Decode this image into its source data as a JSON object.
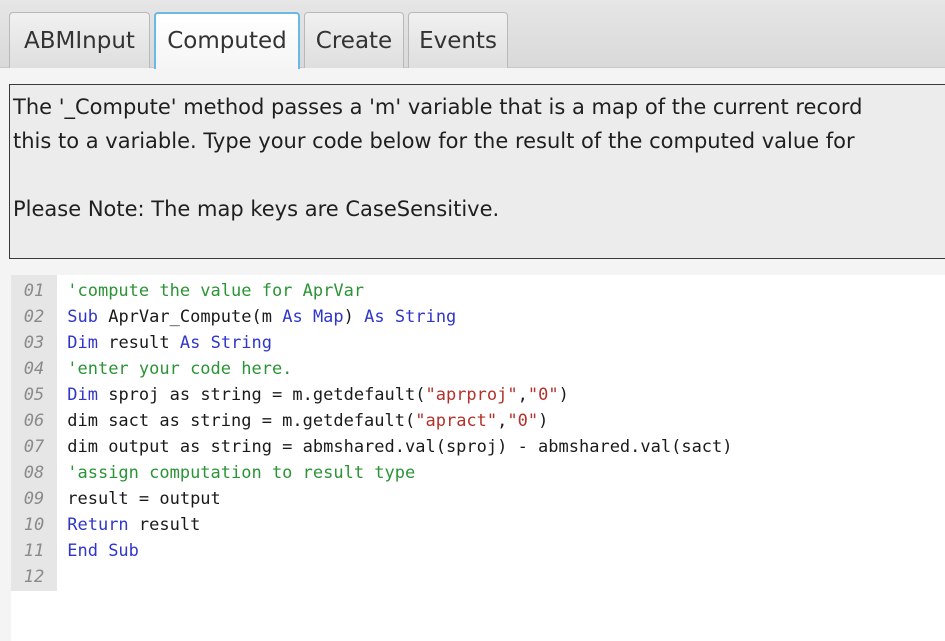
{
  "tabs": [
    {
      "label": "ABMInput"
    },
    {
      "label": "Computed",
      "active": true
    },
    {
      "label": "Create"
    },
    {
      "label": "Events"
    }
  ],
  "description": {
    "line1": "The '_Compute' method passes a 'm' variable that is a map of the current record",
    "line2": "this to a variable. Type your code below for the result of the computed value for",
    "note": "Please Note: The map keys are CaseSensitive."
  },
  "editor": {
    "lines": [
      {
        "num": "01",
        "segments": [
          {
            "t": "'compute the value for AprVar",
            "c": "cm"
          }
        ]
      },
      {
        "num": "02",
        "segments": [
          {
            "t": "Sub",
            "c": "kw"
          },
          {
            "t": " AprVar_Compute(m ",
            "c": "txt"
          },
          {
            "t": "As",
            "c": "kw"
          },
          {
            "t": " ",
            "c": "txt"
          },
          {
            "t": "Map",
            "c": "kw"
          },
          {
            "t": ") ",
            "c": "txt"
          },
          {
            "t": "As",
            "c": "kw"
          },
          {
            "t": " ",
            "c": "txt"
          },
          {
            "t": "String",
            "c": "kw"
          }
        ]
      },
      {
        "num": "03",
        "segments": [
          {
            "t": "Dim",
            "c": "kw"
          },
          {
            "t": " result ",
            "c": "txt"
          },
          {
            "t": "As",
            "c": "kw"
          },
          {
            "t": " ",
            "c": "txt"
          },
          {
            "t": "String",
            "c": "kw"
          }
        ]
      },
      {
        "num": "04",
        "segments": [
          {
            "t": "'enter your code here.",
            "c": "cm"
          }
        ]
      },
      {
        "num": "05",
        "segments": [
          {
            "t": "Dim",
            "c": "kw"
          },
          {
            "t": " sproj as string = m.getdefault(",
            "c": "txt"
          },
          {
            "t": "\"aprproj\"",
            "c": "st"
          },
          {
            "t": ",",
            "c": "txt"
          },
          {
            "t": "\"0\"",
            "c": "st"
          },
          {
            "t": ")",
            "c": "txt"
          }
        ]
      },
      {
        "num": "06",
        "segments": [
          {
            "t": "dim sact as string = m.getdefault(",
            "c": "txt"
          },
          {
            "t": "\"apract\"",
            "c": "st"
          },
          {
            "t": ",",
            "c": "txt"
          },
          {
            "t": "\"0\"",
            "c": "st"
          },
          {
            "t": ")",
            "c": "txt"
          }
        ]
      },
      {
        "num": "07",
        "segments": [
          {
            "t": "dim output as string = abmshared.val(sproj) - abmshared.val(sact)",
            "c": "txt"
          }
        ]
      },
      {
        "num": "08",
        "segments": [
          {
            "t": "'assign computation to result type",
            "c": "cm"
          }
        ]
      },
      {
        "num": "09",
        "segments": [
          {
            "t": "result = output",
            "c": "txt"
          }
        ]
      },
      {
        "num": "10",
        "segments": [
          {
            "t": "Return",
            "c": "kw"
          },
          {
            "t": " result",
            "c": "txt"
          }
        ]
      },
      {
        "num": "11",
        "segments": [
          {
            "t": "End Sub",
            "c": "kw"
          }
        ]
      },
      {
        "num": "12",
        "segments": []
      }
    ]
  },
  "colors": {
    "keyword": "#2f36c9",
    "comment": "#2b9436",
    "string": "#b3312b",
    "active_tab_border": "#6bb7e6"
  }
}
